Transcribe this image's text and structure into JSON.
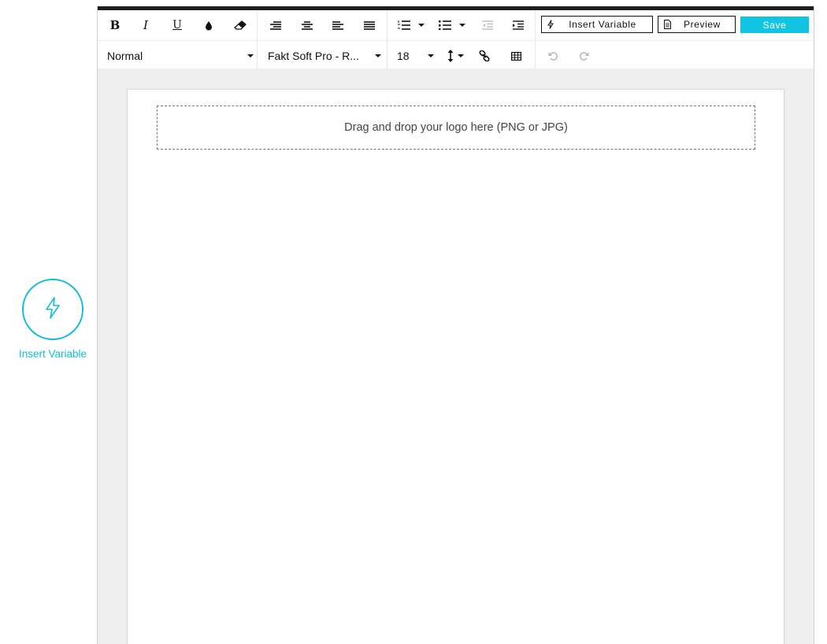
{
  "sidebar": {
    "insert_variable_label": "Insert Variable",
    "accent_color": "#11bdd8"
  },
  "toolbar": {
    "row1": {
      "format_buttons": [
        {
          "name": "bold-button",
          "glyph": "B",
          "icon": "bold-icon"
        },
        {
          "name": "italic-button",
          "glyph": "I",
          "icon": "italic-icon"
        },
        {
          "name": "underline-button",
          "glyph": "U",
          "icon": "underline-icon"
        },
        {
          "name": "text-color-button",
          "icon": "ink-drop-icon"
        },
        {
          "name": "clear-format-button",
          "icon": "eraser-icon"
        }
      ],
      "align_buttons": [
        "align-right-icon",
        "align-center-icon",
        "align-left-icon",
        "align-justify-icon"
      ],
      "list_buttons": [
        "ordered-list-icon",
        "bullet-list-icon",
        "outdent-icon",
        "indent-icon"
      ],
      "insert_variable_label": "Insert Variable",
      "preview_label": "Preview",
      "save_label": "Save",
      "save_color": "#11c5e2"
    },
    "row2": {
      "block_style": "Normal",
      "font_family": "Fakt Soft Pro - R...",
      "font_size": "18",
      "tools": [
        "line-height-icon",
        "link-icon",
        "table-icon",
        "undo-icon",
        "redo-icon"
      ]
    }
  },
  "canvas": {
    "logo_dropzone_text": "Drag and drop your logo here (PNG or JPG)"
  }
}
